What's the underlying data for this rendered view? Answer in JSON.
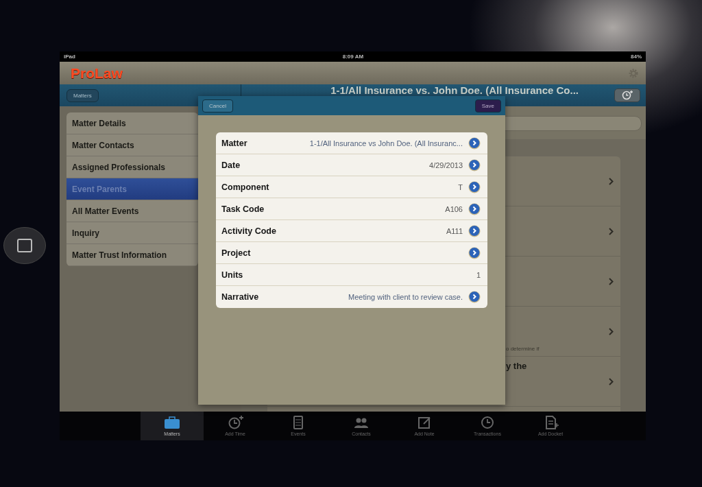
{
  "status_bar": {
    "device": "iPad",
    "time": "8:09 AM",
    "battery": "84%"
  },
  "app_header": {
    "logo": "ProLaw"
  },
  "nav_bar": {
    "back_button": "Matters",
    "title": "1-1/All Insurance vs. John Doe. (All Insurance Co..."
  },
  "sidebar": {
    "items": [
      {
        "label": "Matter Details",
        "selected": false
      },
      {
        "label": "Matter Contacts",
        "selected": false
      },
      {
        "label": "Assigned Professionals",
        "selected": false
      },
      {
        "label": "Event Parents",
        "selected": true
      },
      {
        "label": "All Matter Events",
        "selected": false
      },
      {
        "label": "Inquiry",
        "selected": false
      },
      {
        "label": "Matter Trust Information",
        "selected": false
      }
    ]
  },
  "detail_list": {
    "rows": [
      {},
      {},
      {},
      {
        "note": "o determine if"
      },
      {
        "title": "y the"
      }
    ]
  },
  "modal": {
    "cancel": "Cancel",
    "save": "Save",
    "fields": [
      {
        "label": "Matter",
        "value": "1-1/All Insurance vs John Doe. (All Insuranc...",
        "link": true,
        "accent": true
      },
      {
        "label": "Date",
        "value": "4/29/2013",
        "link": true,
        "accent": false
      },
      {
        "label": "Component",
        "value": "T",
        "link": true,
        "accent": false
      },
      {
        "label": "Task Code",
        "value": "A106",
        "link": true,
        "accent": false
      },
      {
        "label": "Activity Code",
        "value": "A111",
        "link": true,
        "accent": false
      },
      {
        "label": "Project",
        "link": true
      },
      {
        "label": "Units",
        "value": "1",
        "link": false,
        "accent": false
      },
      {
        "label": "Narrative",
        "value": "Meeting with client to review case.",
        "link": true,
        "accent": true
      }
    ]
  },
  "tab_bar": {
    "tabs": [
      {
        "label": "Matters",
        "kind": "briefcase",
        "selected": true
      },
      {
        "label": "Add Time",
        "kind": "clock-plus",
        "selected": false
      },
      {
        "label": "Events",
        "kind": "calendar",
        "selected": false
      },
      {
        "label": "Contacts",
        "kind": "people",
        "selected": false
      },
      {
        "label": "Add Note",
        "kind": "note",
        "selected": false
      },
      {
        "label": "Transactions",
        "kind": "clock",
        "selected": false
      },
      {
        "label": "Add Docket",
        "kind": "doc-plus",
        "selected": false
      }
    ]
  }
}
